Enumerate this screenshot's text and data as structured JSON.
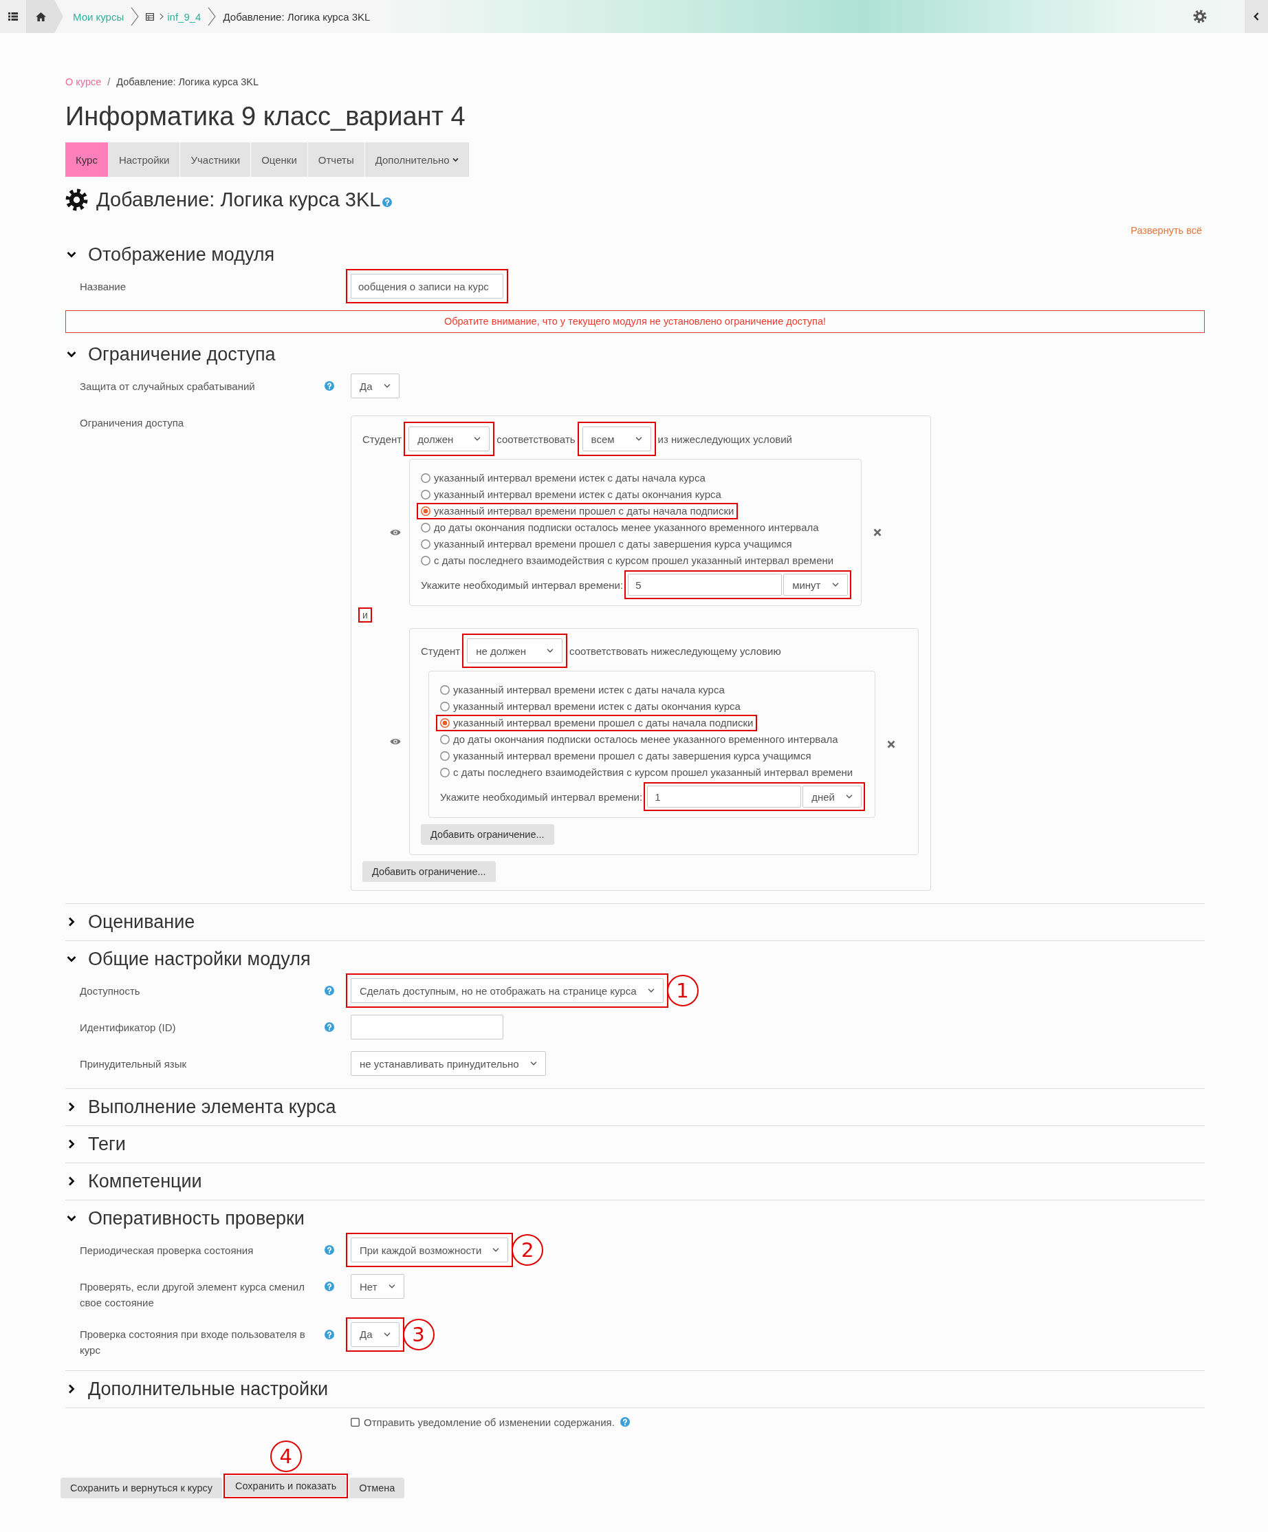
{
  "header": {
    "breadcrumb": [
      {
        "label": "Мои курсы",
        "kind": "link"
      },
      {
        "label": "inf_9_4",
        "kind": "course"
      },
      {
        "label": "Добавление: Логика курса 3KL",
        "kind": "current"
      }
    ]
  },
  "breadcrumb": {
    "separator": "/",
    "items": [
      {
        "label": "О курсе",
        "kind": "link"
      },
      {
        "label": "Добавление: Логика курса 3KL",
        "kind": "current"
      }
    ]
  },
  "course_title": "Информатика 9 класс_вариант 4",
  "tabs": [
    {
      "label": "Курс",
      "selected": true
    },
    {
      "label": "Настройки",
      "selected": false
    },
    {
      "label": "Участники",
      "selected": false
    },
    {
      "label": "Оценки",
      "selected": false
    },
    {
      "label": "Отчеты",
      "selected": false
    },
    {
      "label": "Дополнительно",
      "selected": false,
      "dropdown": true
    }
  ],
  "page_heading": {
    "title": "Добавление: Логика курса 3KL",
    "help": true
  },
  "expand_all": "Развернуть всё",
  "sections": [
    {
      "title": "Отображение модуля",
      "expanded": true,
      "fields": [
        {
          "kind": "input",
          "label": "Название",
          "value": "ообщения о записи на курс",
          "highlighted": true
        },
        {
          "kind": "notice",
          "text": "Обратите внимание, что у текущего модуля не установлено ограничение доступа!"
        }
      ]
    },
    {
      "title": "Ограничение доступа",
      "expanded": true,
      "fields": [
        {
          "kind": "select",
          "label": "Защита от случайных срабатываний",
          "help": true,
          "value": "Да"
        },
        {
          "kind": "restrictions",
          "label": "Ограничения доступа",
          "set": {
            "prefix": "Студент",
            "must": {
              "value": "должен",
              "highlighted": true
            },
            "connector": "соответствовать",
            "match": {
              "value": "всем",
              "highlighted": true
            },
            "suffix": "из нижеследующих условий",
            "children": [
              {
                "kind": "condition",
                "options": [
                  {
                    "label": "указанный интервал времени истек с даты начала курса",
                    "selected": false
                  },
                  {
                    "label": "указанный интервал времени истек с даты окончания курса",
                    "selected": false
                  },
                  {
                    "label": "указанный интервал времени прошел с даты начала подписки",
                    "selected": true,
                    "highlighted": true
                  },
                  {
                    "label": "до даты окончания подписки осталось менее указанного временного интервала",
                    "selected": false
                  },
                  {
                    "label": "указанный интервал времени прошел с даты завершения курса учащимся",
                    "selected": false
                  },
                  {
                    "label": "с даты последнего взаимодействия с курсом прошел указанный интервал времени",
                    "selected": false
                  }
                ],
                "interval": {
                  "label": "Укажите необходимый интервал времени:",
                  "value": "5",
                  "unit": "минут",
                  "highlighted": true
                }
              },
              {
                "kind": "operator",
                "text": "и",
                "highlighted": true
              },
              {
                "kind": "set",
                "prefix": "Студент",
                "must": {
                  "value": "не должен",
                  "highlighted": true
                },
                "suffix": "соответствовать нижеследующему условию",
                "children": [
                  {
                    "kind": "condition",
                    "options": [
                      {
                        "label": "указанный интервал времени истек с даты начала курса",
                        "selected": false
                      },
                      {
                        "label": "указанный интервал времени истек с даты окончания курса",
                        "selected": false
                      },
                      {
                        "label": "указанный интервал времени прошел с даты начала подписки",
                        "selected": true,
                        "highlighted": true
                      },
                      {
                        "label": "до даты окончания подписки осталось менее указанного временного интервала",
                        "selected": false
                      },
                      {
                        "label": "указанный интервал времени прошел с даты завершения курса учащимся",
                        "selected": false
                      },
                      {
                        "label": "с даты последнего взаимодействия с курсом прошел указанный интервал времени",
                        "selected": false
                      }
                    ],
                    "interval": {
                      "label": "Укажите необходимый интервал времени:",
                      "value": "1",
                      "unit": "дней",
                      "highlighted": true
                    }
                  }
                ],
                "add_button": "Добавить ограничение..."
              }
            ],
            "add_button": "Добавить ограничение..."
          }
        }
      ]
    },
    {
      "title": "Оценивание",
      "expanded": false
    },
    {
      "title": "Общие настройки модуля",
      "expanded": true,
      "fields": [
        {
          "kind": "select",
          "label": "Доступность",
          "help": true,
          "value": "Сделать доступным, но не отображать на странице курса",
          "highlighted": true,
          "callout": "1"
        },
        {
          "kind": "input",
          "label": "Идентификатор (ID)",
          "help": true
        },
        {
          "kind": "select",
          "label": "Принудительный язык",
          "value": "не устанавливать принудительно"
        }
      ]
    },
    {
      "title": "Выполнение элемента курса",
      "expanded": false
    },
    {
      "title": "Теги",
      "expanded": false
    },
    {
      "title": "Компетенции",
      "expanded": false
    },
    {
      "title": "Оперативность проверки",
      "expanded": true,
      "fields": [
        {
          "kind": "select",
          "label": "Периодическая проверка состояния",
          "help": true,
          "value": "При каждой возможности",
          "highlighted": true,
          "callout": "2"
        },
        {
          "kind": "select",
          "label": "Проверять, если другой элемент курса сменил свое состояние",
          "help": true,
          "value": "Нет"
        },
        {
          "kind": "select",
          "label": "Проверка состояния при входе пользователя в курс",
          "help": true,
          "value": "Да",
          "highlighted": true,
          "callout": "3"
        }
      ]
    },
    {
      "title": "Дополнительные настройки",
      "expanded": false
    }
  ],
  "footer": {
    "checkbox": {
      "label": "Отправить уведомление об изменении содержания.",
      "checked": false,
      "help": true
    },
    "buttons": [
      {
        "label": "Сохранить и вернуться к курсу"
      },
      {
        "label": "Сохранить и показать",
        "highlighted": true,
        "callout": "4"
      },
      {
        "label": "Отмена"
      }
    ]
  }
}
